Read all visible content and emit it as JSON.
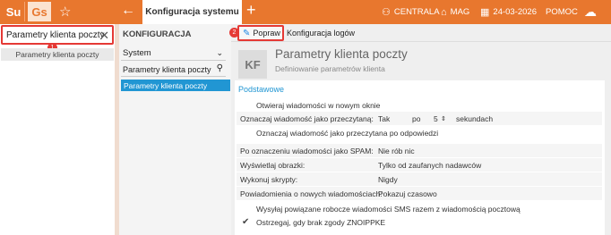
{
  "topbar": {
    "logo_su": "Su",
    "logo_gs": "Gs",
    "tab_title": "Konfiguracja systemu",
    "right_items": [
      {
        "label": "CENTRALA",
        "icon": "org-icon"
      },
      {
        "label": "MAG",
        "icon": "warehouse-icon"
      },
      {
        "label": "24-03-2026",
        "icon": "calendar-icon"
      },
      {
        "label": "POMOC",
        "icon": ""
      }
    ]
  },
  "search": {
    "value": "Parametry klienta poczty",
    "badge": "1"
  },
  "left_result": "Parametry klienta poczty",
  "config": {
    "heading": "KONFIGURACJA",
    "select_value": "System",
    "search_value": "Parametry klienta poczty",
    "item": "Parametry klienta poczty"
  },
  "toolbar": {
    "popraw_label": "Popraw",
    "logi_label": "Konfiguracja logów",
    "badge": "2"
  },
  "form": {
    "kf": "KF",
    "title": "Parametry klienta poczty",
    "subtitle": "Definiowanie parametrów klienta",
    "section": "Podstawowe",
    "open_new_window": "Otwieraj wiadomości w nowym oknie",
    "mark_read_label": "Oznaczaj wiadomość jako przeczytaną:",
    "mark_read_value": "Tak",
    "mark_read_po": "po",
    "mark_read_seconds": "5",
    "mark_read_unit": "sekundach",
    "mark_after_reply": "Oznaczaj wiadomość jako przeczytana po odpowiedzi",
    "spam_label": "Po oznaczeniu wiadomości jako SPAM:",
    "spam_value": "Nie rób nic",
    "images_label": "Wyświetlaj obrazki:",
    "images_value": "Tylko od zaufanych nadawców",
    "scripts_label": "Wykonuj skrypty:",
    "scripts_value": "Nigdy",
    "notify_label": "Powiadomienia o nowych wiadomościach:",
    "notify_value": "Pokazuj czasowo",
    "sms_label": "Wysyłaj powiązane robocze wiadomości SMS razem z wiadomością pocztową",
    "warn_label": "Ostrzegaj, gdy brak zgody ZNOIPPKE"
  }
}
